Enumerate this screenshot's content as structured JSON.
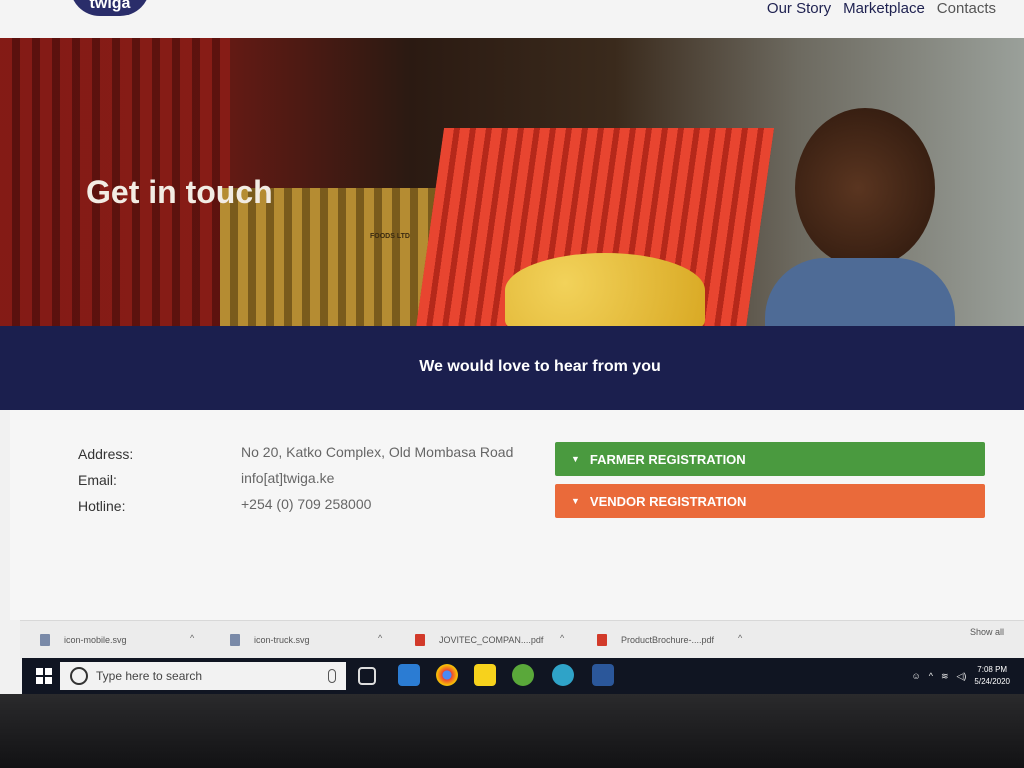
{
  "nav": {
    "logo_text": "twiga",
    "links": [
      "Our Story",
      "Marketplace",
      "Contacts"
    ]
  },
  "hero": {
    "title": "Get in touch",
    "crate_text": "FOODS LTD"
  },
  "banner": {
    "text": "We would love to hear from you"
  },
  "contact": {
    "address_label": "Address:",
    "address_value": "No 20, Katko Complex, Old Mombasa Road",
    "email_label": "Email:",
    "email_value": "info[at]twiga.ke",
    "hotline_label": "Hotline:",
    "hotline_value": "+254 (0) 709 258000"
  },
  "accordions": {
    "farmer": "FARMER REGISTRATION",
    "vendor": "VENDOR REGISTRATION"
  },
  "downloads": {
    "items": [
      "icon-mobile.svg",
      "icon-truck.svg",
      "JOVITEC_COMPAN....pdf",
      "ProductBrochure-....pdf"
    ],
    "show_all": "Show all"
  },
  "taskbar": {
    "search_placeholder": "Type here to search",
    "time": "7:08 PM",
    "date": "5/24/2020"
  },
  "colors": {
    "brand_blue": "#1b1f4e",
    "farmer_green": "#4a9a3f",
    "vendor_orange": "#ea6a3a"
  }
}
